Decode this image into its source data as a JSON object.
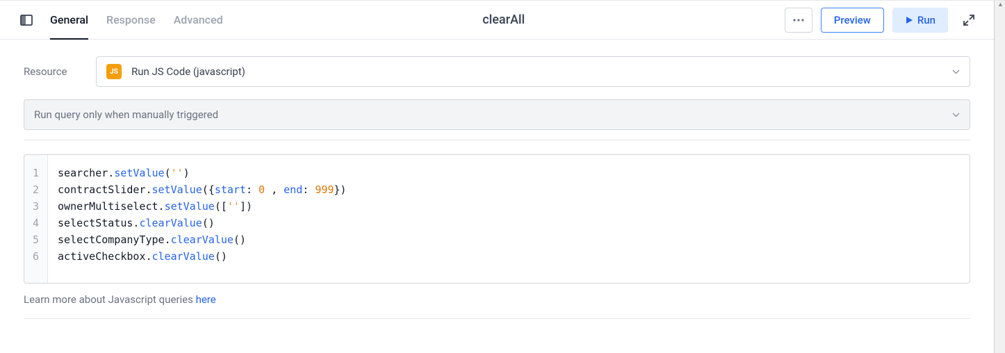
{
  "header": {
    "tabs": {
      "general": "General",
      "response": "Response",
      "advanced": "Advanced"
    },
    "title": "clearAll",
    "preview_label": "Preview",
    "run_label": "Run"
  },
  "resource": {
    "label": "Resource",
    "badge": "JS",
    "text": "Run JS Code (javascript)"
  },
  "trigger": {
    "text": "Run query only when manually triggered"
  },
  "code": {
    "lines": [
      "1",
      "2",
      "3",
      "4",
      "5",
      "6"
    ],
    "l1_searcher": "searcher",
    "l1_setValue": "setValue",
    "l1_str": "''",
    "l2_contractSlider": "contractSlider",
    "l2_setValue": "setValue",
    "l2_start": "start",
    "l2_zero": "0",
    "l2_end": "end",
    "l2_num": "999",
    "l3_owner": "ownerMultiselect",
    "l3_setValue": "setValue",
    "l3_str": "''",
    "l4_selectStatus": "selectStatus",
    "l4_clearValue": "clearValue",
    "l5_selectCompanyType": "selectCompanyType",
    "l5_clearValue": "clearValue",
    "l6_activeCheckbox": "activeCheckbox",
    "l6_clearValue": "clearValue"
  },
  "footer": {
    "learn_text": "Learn more about Javascript queries ",
    "learn_link": "here"
  }
}
